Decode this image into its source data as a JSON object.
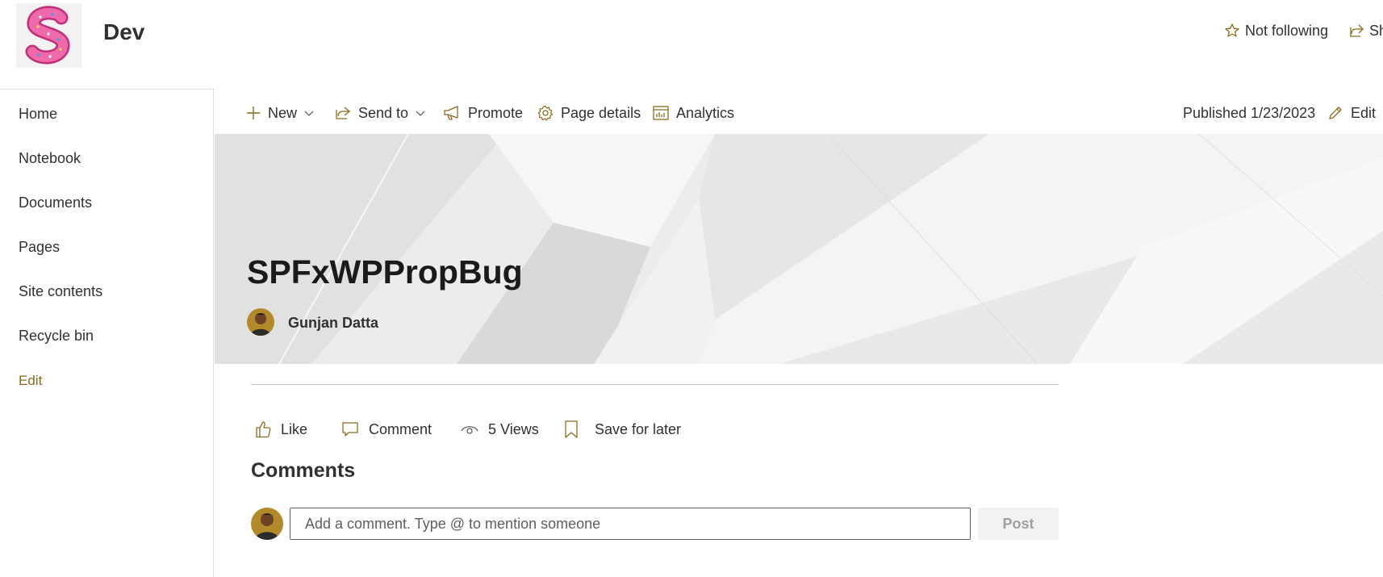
{
  "site": {
    "title": "Dev",
    "actions": {
      "follow_label": "Not following",
      "share_label": "Share"
    }
  },
  "nav": {
    "items": [
      "Home",
      "Notebook",
      "Documents",
      "Pages",
      "Site contents",
      "Recycle bin"
    ],
    "edit_label": "Edit"
  },
  "commandbar": {
    "new_label": "New",
    "send_to_label": "Send to",
    "promote_label": "Promote",
    "page_details_label": "Page details",
    "analytics_label": "Analytics",
    "published_text": "Published 1/23/2023",
    "edit_label": "Edit"
  },
  "page": {
    "title": "SPFxWPPropBug",
    "author": "Gunjan Datta"
  },
  "social": {
    "like_label": "Like",
    "comment_label": "Comment",
    "views_label": "5 Views",
    "save_label": "Save for later"
  },
  "comments": {
    "heading": "Comments",
    "input_placeholder": "Add a comment. Type @ to mention someone",
    "post_label": "Post"
  },
  "colors": {
    "accent": "#8a6c1e",
    "text": "#323130",
    "banner_bg": "#ebebeb",
    "logo_pink": "#e8559a"
  },
  "icons": {
    "new": "plus-icon",
    "send_to": "share-arrow-icon",
    "promote": "megaphone-icon",
    "page_details": "gear-icon",
    "analytics": "bar-chart-icon",
    "edit": "pencil-icon",
    "follow": "star-icon",
    "like": "thumbs-up-icon",
    "comment": "speech-bubble-icon",
    "views": "eye-icon",
    "save": "bookmark-icon"
  }
}
